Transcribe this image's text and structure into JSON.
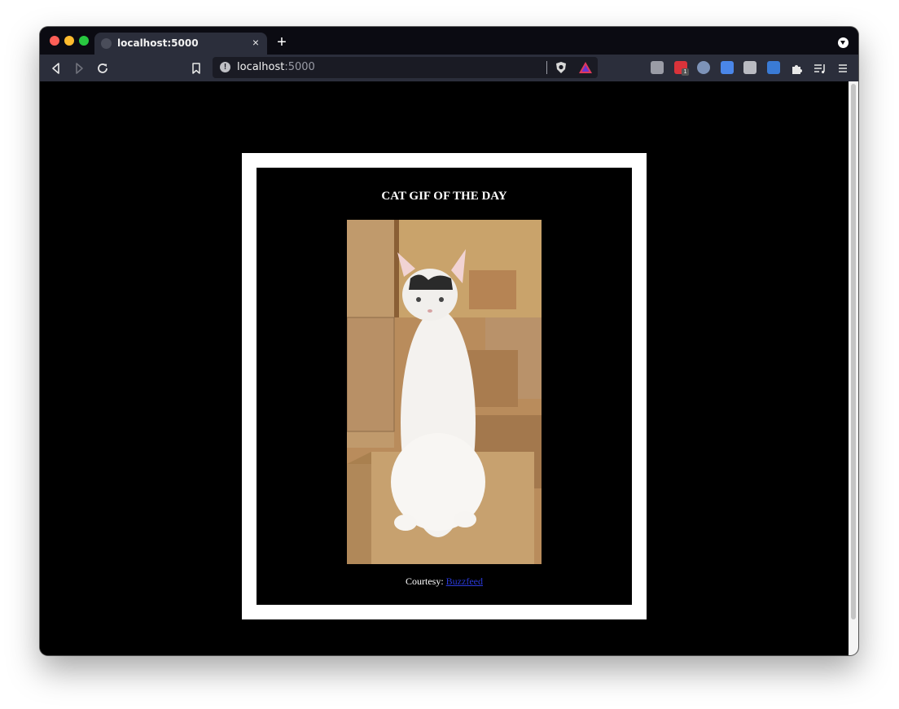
{
  "browser": {
    "tab_title": "localhost:5000",
    "tab_close_glyph": "×",
    "new_tab_glyph": "+",
    "url_host": "localhost",
    "url_port": ":5000",
    "extension_badge": "1",
    "icons": [
      "back-icon",
      "forward-icon",
      "reload-icon",
      "bookmark-icon",
      "site-info-icon",
      "brave-shields-icon",
      "brave-rewards-icon",
      "extensions-icon",
      "reading-list-icon",
      "menu-icon"
    ]
  },
  "page": {
    "title": "CAT GIF OF THE DAY",
    "courtesy_label": "Courtesy: ",
    "courtesy_link": "Buzzfeed",
    "background_color": "#000000",
    "frame_color": "#ffffff",
    "link_color": "#2a3ad8"
  }
}
